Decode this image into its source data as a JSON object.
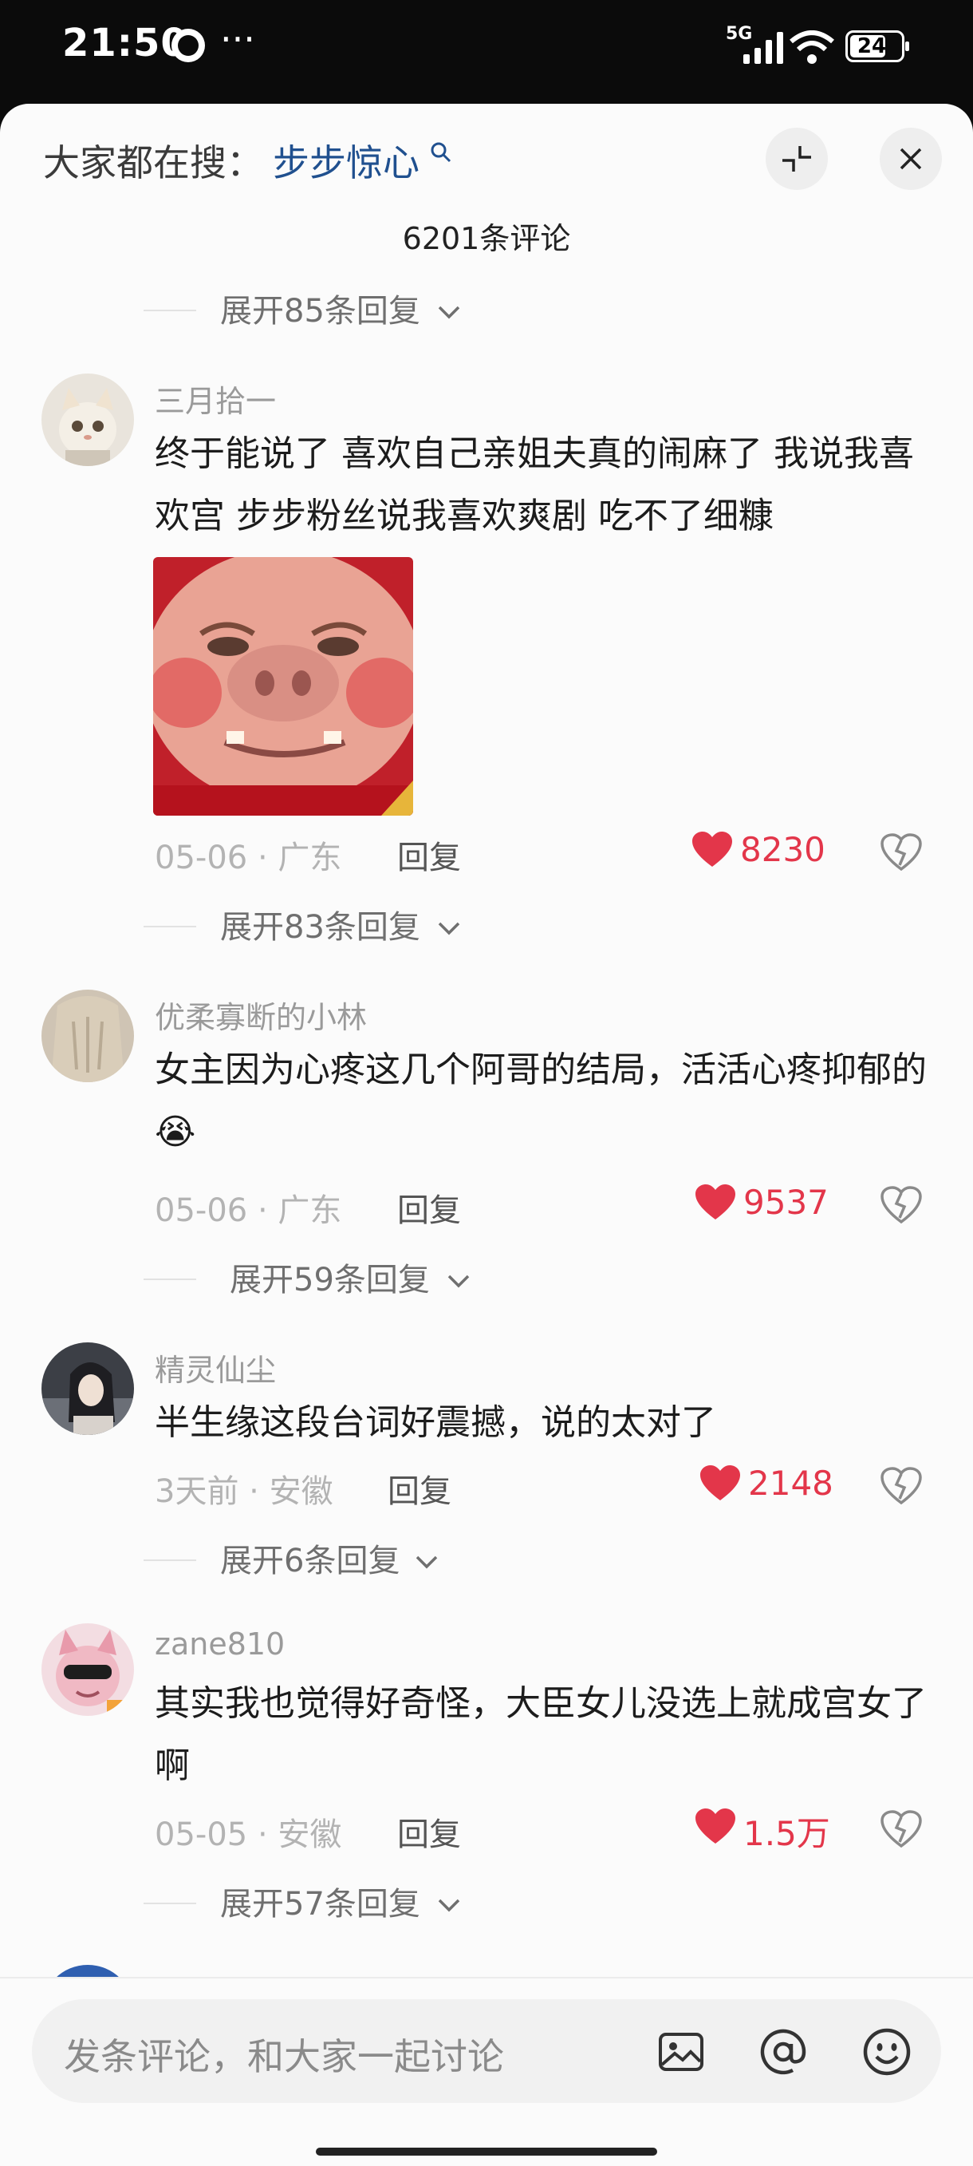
{
  "status": {
    "time": "21:50",
    "dots": "···",
    "network": "5G",
    "battery": "24"
  },
  "header": {
    "search_label": "大家都在搜：",
    "search_keyword": "步步惊心",
    "comment_count": "6201条评论"
  },
  "expand_labels": [
    "展开85条回复",
    "展开83条回复",
    "展开59条回复",
    "展开6条回复",
    "展开57条回复"
  ],
  "comments": [
    {
      "user": "三月拾一",
      "text": "终于能说了  喜欢自己亲姐夫真的闹麻了  我说我喜欢宫 步步粉丝说我喜欢爽剧 吃不了细糠",
      "date": "05-06",
      "location": "广东",
      "reply": "回复",
      "likes": "8230"
    },
    {
      "user": "优柔寡断的小林",
      "text": "女主因为心疼这几个阿哥的结局，活活心疼抑郁的",
      "emoji": "😭",
      "date": "05-06",
      "location": "广东",
      "reply": "回复",
      "likes": "9537"
    },
    {
      "user": "精灵仙尘",
      "text": "半生缘这段台词好震撼，说的太对了",
      "date": "3天前",
      "location": "安徽",
      "reply": "回复",
      "likes": "2148"
    },
    {
      "user": "zane810",
      "text": "其实我也觉得好奇怪，大臣女儿没选上就成宫女了啊",
      "date": "05-05",
      "location": "安徽",
      "reply": "回复",
      "likes": "1.5万"
    }
  ],
  "input": {
    "placeholder": "发条评论，和大家一起讨论"
  },
  "colors": {
    "like": "#e3364a",
    "keyword": "#20508f",
    "background": "#fbfbfb"
  },
  "icons": [
    "search-icon",
    "collapse-icon",
    "close-icon",
    "chevron-down-icon",
    "heart-icon",
    "dislike-icon",
    "image-icon",
    "at-icon",
    "emoji-icon"
  ]
}
